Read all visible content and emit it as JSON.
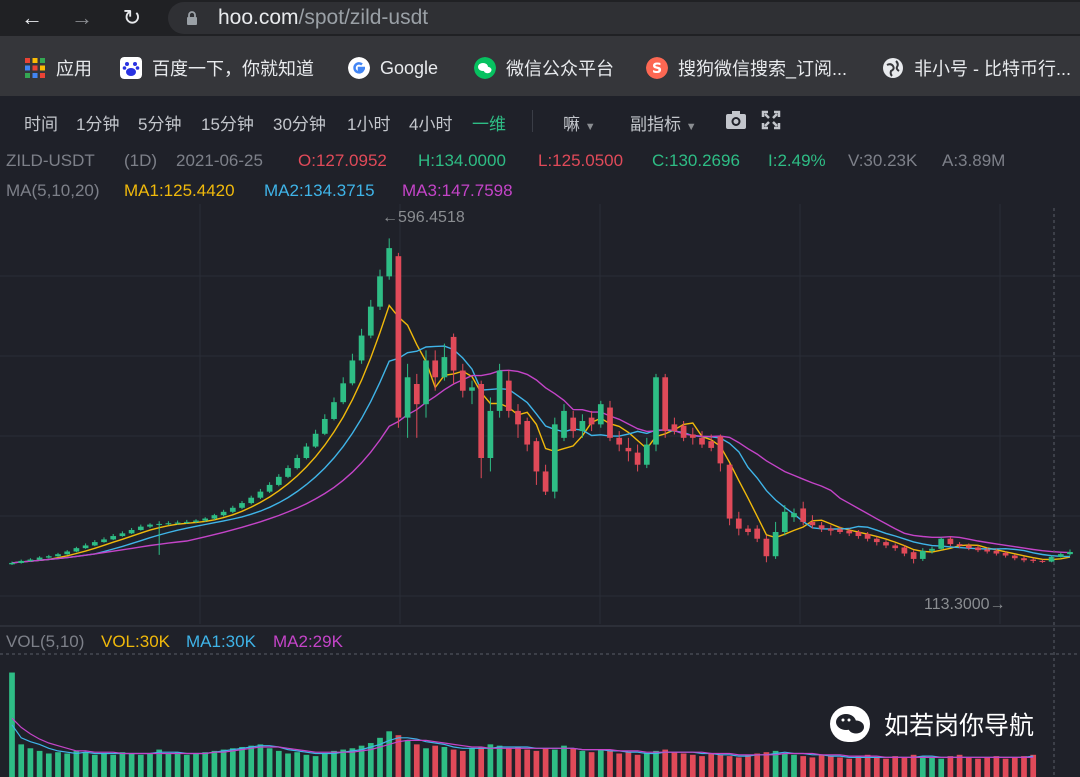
{
  "browser": {
    "url_host": "hoo.com",
    "url_path": "/spot/zild-usdt",
    "bookmarks": [
      "应用",
      "百度一下，你就知道",
      "Google",
      "微信公众平台",
      "搜狗微信搜索_订阅...",
      "非小号 - 比特币行..."
    ]
  },
  "toolbar": {
    "intervals": [
      "时间",
      "1分钟",
      "5分钟",
      "15分钟",
      "30分钟",
      "1小时",
      "4小时",
      "一维"
    ],
    "active_interval": "一维",
    "indicator_menu": "嘛",
    "sub_indicator_menu": "副指标"
  },
  "info": {
    "symbol": "ZILD-USDT",
    "period": "(1D)",
    "date": "2021-06-25",
    "open": "O:127.0952",
    "high": "H:134.0000",
    "low": "L:125.0500",
    "close": "C:130.2696",
    "change": "I:2.49%",
    "volume": "V:30.23K",
    "amount": "A:3.89M"
  },
  "ma": {
    "label": "MA(5,10,20)",
    "ma1": "MA1:125.4420",
    "ma2": "MA2:134.3715",
    "ma3": "MA3:147.7598"
  },
  "vol": {
    "label": "VOL(5,10)",
    "vol": "VOL:30K",
    "ma1": "MA1:30K",
    "ma2": "MA2:29K"
  },
  "annotations": {
    "high_label": "←596.4518",
    "low_label": "113.3000→"
  },
  "watermark": "如若岗你导航",
  "colors": {
    "up": "#2ebd85",
    "down": "#e04a59",
    "ma1": "#f0b90b",
    "ma2": "#3fb4e8",
    "ma3": "#c444c8"
  },
  "chart_data": {
    "type": "candlestick",
    "symbol": "ZILD-USDT",
    "interval": "1D",
    "price_range": [
      113.3,
      596.4518
    ],
    "candles": [
      {
        "o": 112.0,
        "c": 114.0,
        "h": 116.0,
        "l": 111.0
      },
      {
        "o": 114.0,
        "c": 117.0,
        "h": 119.0,
        "l": 113.0
      },
      {
        "o": 117.0,
        "c": 119.0,
        "h": 121.0,
        "l": 116.0
      },
      {
        "o": 119.0,
        "c": 122.0,
        "h": 124.0,
        "l": 118.0
      },
      {
        "o": 122.0,
        "c": 124.0,
        "h": 126.0,
        "l": 121.0
      },
      {
        "o": 124.0,
        "c": 127.0,
        "h": 129.0,
        "l": 123.0
      },
      {
        "o": 127.0,
        "c": 131.0,
        "h": 133.0,
        "l": 126.0
      },
      {
        "o": 131.0,
        "c": 136.0,
        "h": 138.0,
        "l": 130.0
      },
      {
        "o": 136.0,
        "c": 140.0,
        "h": 143.0,
        "l": 135.0
      },
      {
        "o": 140.0,
        "c": 145.0,
        "h": 148.0,
        "l": 139.0
      },
      {
        "o": 145.0,
        "c": 149.0,
        "h": 152.0,
        "l": 144.0
      },
      {
        "o": 149.0,
        "c": 154.0,
        "h": 157.0,
        "l": 148.0
      },
      {
        "o": 154.0,
        "c": 158.0,
        "h": 161.0,
        "l": 153.0
      },
      {
        "o": 158.0,
        "c": 163.0,
        "h": 166.0,
        "l": 157.0
      },
      {
        "o": 163.0,
        "c": 168.0,
        "h": 171.0,
        "l": 162.0
      },
      {
        "o": 168.0,
        "c": 171.0,
        "h": 173.0,
        "l": 166.0
      },
      {
        "o": 171.0,
        "c": 172.0,
        "h": 176.0,
        "l": 126.0
      },
      {
        "o": 172.0,
        "c": 173.0,
        "h": 176.0,
        "l": 170.0
      },
      {
        "o": 173.0,
        "c": 174.0,
        "h": 177.0,
        "l": 171.0
      },
      {
        "o": 174.0,
        "c": 175.0,
        "h": 178.0,
        "l": 172.0
      },
      {
        "o": 175.0,
        "c": 177.0,
        "h": 179.0,
        "l": 173.0
      },
      {
        "o": 177.0,
        "c": 180.0,
        "h": 182.0,
        "l": 175.0
      },
      {
        "o": 180.0,
        "c": 185.0,
        "h": 187.0,
        "l": 178.0
      },
      {
        "o": 185.0,
        "c": 190.0,
        "h": 193.0,
        "l": 183.0
      },
      {
        "o": 190.0,
        "c": 196.0,
        "h": 199.0,
        "l": 188.0
      },
      {
        "o": 196.0,
        "c": 203.0,
        "h": 206.0,
        "l": 194.0
      },
      {
        "o": 203.0,
        "c": 211.0,
        "h": 214.0,
        "l": 201.0
      },
      {
        "o": 211.0,
        "c": 220.0,
        "h": 224.0,
        "l": 209.0
      },
      {
        "o": 220.0,
        "c": 230.0,
        "h": 234.0,
        "l": 218.0
      },
      {
        "o": 230.0,
        "c": 242.0,
        "h": 246.0,
        "l": 228.0
      },
      {
        "o": 242.0,
        "c": 255.0,
        "h": 259.0,
        "l": 240.0
      },
      {
        "o": 255.0,
        "c": 270.0,
        "h": 275.0,
        "l": 253.0
      },
      {
        "o": 270.0,
        "c": 287.0,
        "h": 292.0,
        "l": 268.0
      },
      {
        "o": 287.0,
        "c": 306.0,
        "h": 312.0,
        "l": 285.0
      },
      {
        "o": 306.0,
        "c": 328.0,
        "h": 335.0,
        "l": 304.0
      },
      {
        "o": 328.0,
        "c": 353.0,
        "h": 360.0,
        "l": 326.0
      },
      {
        "o": 353.0,
        "c": 381.0,
        "h": 390.0,
        "l": 350.0
      },
      {
        "o": 381.0,
        "c": 415.0,
        "h": 425.0,
        "l": 378.0
      },
      {
        "o": 415.0,
        "c": 452.0,
        "h": 462.0,
        "l": 410.0
      },
      {
        "o": 452.0,
        "c": 495.0,
        "h": 505.0,
        "l": 448.0
      },
      {
        "o": 495.0,
        "c": 540.0,
        "h": 550.0,
        "l": 490.0
      },
      {
        "o": 540.0,
        "c": 582.0,
        "h": 596.4518,
        "l": 535.0
      },
      {
        "o": 570.0,
        "c": 330.0,
        "h": 575.0,
        "l": 315.0
      },
      {
        "o": 330.0,
        "c": 390.0,
        "h": 410.0,
        "l": 300.0
      },
      {
        "o": 380.0,
        "c": 350.0,
        "h": 395.0,
        "l": 300.0
      },
      {
        "o": 350.0,
        "c": 415.0,
        "h": 430.0,
        "l": 330.0
      },
      {
        "o": 415.0,
        "c": 390.0,
        "h": 430.0,
        "l": 370.0
      },
      {
        "o": 390.0,
        "c": 420.0,
        "h": 440.0,
        "l": 385.0
      },
      {
        "o": 450.0,
        "c": 400.0,
        "h": 455.0,
        "l": 380.0
      },
      {
        "o": 400.0,
        "c": 370.0,
        "h": 410.0,
        "l": 360.0
      },
      {
        "o": 370.0,
        "c": 375.0,
        "h": 385.0,
        "l": 350.0
      },
      {
        "o": 380.0,
        "c": 270.0,
        "h": 385.0,
        "l": 240.0
      },
      {
        "o": 270.0,
        "c": 340.0,
        "h": 360.0,
        "l": 250.0
      },
      {
        "o": 340.0,
        "c": 400.0,
        "h": 410.0,
        "l": 330.0
      },
      {
        "o": 385.0,
        "c": 340.0,
        "h": 400.0,
        "l": 330.0
      },
      {
        "o": 340.0,
        "c": 320.0,
        "h": 350.0,
        "l": 300.0
      },
      {
        "o": 325.0,
        "c": 290.0,
        "h": 330.0,
        "l": 280.0
      },
      {
        "o": 295.0,
        "c": 250.0,
        "h": 300.0,
        "l": 230.0
      },
      {
        "o": 250.0,
        "c": 220.0,
        "h": 260.0,
        "l": 215.0
      },
      {
        "o": 220.0,
        "c": 320.0,
        "h": 330.0,
        "l": 210.0
      },
      {
        "o": 300.0,
        "c": 340.0,
        "h": 350.0,
        "l": 295.0
      },
      {
        "o": 330.0,
        "c": 310.0,
        "h": 340.0,
        "l": 300.0
      },
      {
        "o": 310.0,
        "c": 325.0,
        "h": 335.0,
        "l": 300.0
      },
      {
        "o": 330.0,
        "c": 320.0,
        "h": 340.0,
        "l": 310.0
      },
      {
        "o": 320.0,
        "c": 350.0,
        "h": 355.0,
        "l": 315.0
      },
      {
        "o": 345.0,
        "c": 300.0,
        "h": 355.0,
        "l": 295.0
      },
      {
        "o": 300.0,
        "c": 290.0,
        "h": 310.0,
        "l": 280.0
      },
      {
        "o": 285.0,
        "c": 280.0,
        "h": 300.0,
        "l": 265.0
      },
      {
        "o": 278.0,
        "c": 260.0,
        "h": 290.0,
        "l": 250.0
      },
      {
        "o": 260.0,
        "c": 290.0,
        "h": 300.0,
        "l": 255.0
      },
      {
        "o": 290.0,
        "c": 390.0,
        "h": 395.0,
        "l": 280.0
      },
      {
        "o": 390.0,
        "c": 310.0,
        "h": 395.0,
        "l": 300.0
      },
      {
        "o": 320.0,
        "c": 310.0,
        "h": 330.0,
        "l": 305.0
      },
      {
        "o": 318.0,
        "c": 300.0,
        "h": 325.0,
        "l": 295.0
      },
      {
        "o": 305.0,
        "c": 300.0,
        "h": 315.0,
        "l": 290.0
      },
      {
        "o": 300.0,
        "c": 290.0,
        "h": 310.0,
        "l": 285.0
      },
      {
        "o": 295.0,
        "c": 285.0,
        "h": 305.0,
        "l": 280.0
      },
      {
        "o": 302.0,
        "c": 262.0,
        "h": 305.0,
        "l": 250.0
      },
      {
        "o": 260.0,
        "c": 180.0,
        "h": 262.0,
        "l": 170.0
      },
      {
        "o": 180.0,
        "c": 165.0,
        "h": 190.0,
        "l": 155.0
      },
      {
        "o": 165.0,
        "c": 160.0,
        "h": 170.0,
        "l": 155.0
      },
      {
        "o": 165.0,
        "c": 150.0,
        "h": 170.0,
        "l": 145.0
      },
      {
        "o": 150.0,
        "c": 124.0,
        "h": 155.0,
        "l": 115.0
      },
      {
        "o": 124.0,
        "c": 160.0,
        "h": 175.0,
        "l": 120.0
      },
      {
        "o": 160.0,
        "c": 190.0,
        "h": 200.0,
        "l": 155.0
      },
      {
        "o": 182.0,
        "c": 188.0,
        "h": 195.0,
        "l": 175.0
      },
      {
        "o": 195.0,
        "c": 175.0,
        "h": 205.0,
        "l": 170.0
      },
      {
        "o": 175.0,
        "c": 170.0,
        "h": 185.0,
        "l": 165.0
      },
      {
        "o": 170.0,
        "c": 165.0,
        "h": 175.0,
        "l": 160.0
      },
      {
        "o": 165.0,
        "c": 162.0,
        "h": 170.0,
        "l": 155.0
      },
      {
        "o": 164.0,
        "c": 160.0,
        "h": 168.0,
        "l": 157.0
      },
      {
        "o": 162.0,
        "c": 158.0,
        "h": 165.0,
        "l": 154.0
      },
      {
        "o": 160.0,
        "c": 154.0,
        "h": 163.0,
        "l": 150.0
      },
      {
        "o": 157.0,
        "c": 150.0,
        "h": 160.0,
        "l": 146.0
      },
      {
        "o": 150.0,
        "c": 145.0,
        "h": 153.0,
        "l": 140.0
      },
      {
        "o": 145.0,
        "c": 140.0,
        "h": 148.0,
        "l": 136.0
      },
      {
        "o": 140.0,
        "c": 136.0,
        "h": 143.0,
        "l": 132.0
      },
      {
        "o": 137.0,
        "c": 128.0,
        "h": 140.0,
        "l": 124.0
      },
      {
        "o": 130.0,
        "c": 120.0,
        "h": 133.0,
        "l": 113.3
      },
      {
        "o": 120.0,
        "c": 132.0,
        "h": 136.0,
        "l": 117.0
      },
      {
        "o": 132.0,
        "c": 135.0,
        "h": 138.0,
        "l": 128.0
      },
      {
        "o": 135.0,
        "c": 150.0,
        "h": 152.0,
        "l": 133.0
      },
      {
        "o": 150.0,
        "c": 142.0,
        "h": 153.0,
        "l": 139.0
      },
      {
        "o": 142.0,
        "c": 140.0,
        "h": 145.0,
        "l": 136.0
      },
      {
        "o": 140.0,
        "c": 136.0,
        "h": 143.0,
        "l": 133.0
      },
      {
        "o": 137.0,
        "c": 133.0,
        "h": 140.0,
        "l": 130.0
      },
      {
        "o": 134.0,
        "c": 131.0,
        "h": 137.0,
        "l": 128.0
      },
      {
        "o": 132.0,
        "c": 128.0,
        "h": 135.0,
        "l": 125.0
      },
      {
        "o": 129.0,
        "c": 125.0,
        "h": 131.0,
        "l": 122.0
      },
      {
        "o": 125.0,
        "c": 121.0,
        "h": 127.0,
        "l": 118.0
      },
      {
        "o": 121.0,
        "c": 118.0,
        "h": 124.0,
        "l": 115.0
      },
      {
        "o": 119.0,
        "c": 117.0,
        "h": 121.0,
        "l": 114.0
      },
      {
        "o": 117.0,
        "c": 116.0,
        "h": 119.0,
        "l": 114.0
      },
      {
        "o": 116.0,
        "c": 123.0,
        "h": 125.0,
        "l": 115.0
      },
      {
        "o": 123.0,
        "c": 127.0,
        "h": 129.0,
        "l": 122.0
      },
      {
        "o": 127.0952,
        "c": 130.2696,
        "h": 134.0,
        "l": 125.05
      }
    ],
    "volume": [
      80,
      25,
      22,
      20,
      18,
      19,
      18,
      20,
      19,
      17,
      18,
      17,
      19,
      18,
      17,
      18,
      21,
      18,
      19,
      17,
      18,
      19,
      20,
      21,
      22,
      23,
      24,
      25,
      22,
      20,
      18,
      19,
      17,
      16,
      18,
      20,
      21,
      22,
      24,
      26,
      30,
      35,
      32,
      28,
      25,
      22,
      24,
      23,
      21,
      20,
      22,
      23,
      25,
      24,
      22,
      23,
      21,
      20,
      22,
      21,
      24,
      22,
      20,
      19,
      21,
      20,
      18,
      19,
      17,
      18,
      20,
      21,
      19,
      18,
      17,
      16,
      18,
      17,
      16,
      15,
      17,
      18,
      19,
      20,
      18,
      17,
      16,
      15,
      17,
      16,
      15,
      14,
      16,
      17,
      15,
      14,
      16,
      15,
      17,
      16,
      15,
      14,
      16,
      17,
      15,
      14,
      15,
      16,
      14,
      15,
      16,
      17
    ],
    "volume_ma1": [
      40,
      30,
      27,
      25,
      22,
      20,
      19,
      18,
      19,
      18,
      18,
      18,
      18,
      18,
      18,
      18,
      19,
      19,
      19,
      18,
      18,
      18,
      19,
      20,
      21,
      22,
      23,
      24,
      24,
      23,
      21,
      20,
      19,
      18,
      18,
      18,
      19,
      20,
      21,
      23,
      25,
      28,
      30,
      30,
      29,
      27,
      26,
      25,
      23,
      22,
      22,
      22,
      22,
      23,
      23,
      23,
      23,
      22,
      22,
      22,
      22,
      22,
      21,
      21,
      21,
      20,
      20,
      19,
      19,
      18,
      18,
      19,
      19,
      19,
      19,
      18,
      18,
      17,
      17,
      16,
      16,
      17,
      17,
      18,
      19,
      18,
      18,
      17,
      17,
      16,
      16,
      15,
      15,
      15,
      15,
      15,
      15,
      15,
      15,
      16,
      16,
      15,
      15,
      15,
      15,
      15,
      15,
      15,
      15,
      15,
      15,
      16
    ],
    "volume_ma2": [
      45,
      38,
      33,
      29,
      26,
      24,
      22,
      20,
      20,
      19,
      19,
      19,
      18,
      18,
      18,
      18,
      18,
      18,
      18,
      18,
      18,
      18,
      19,
      19,
      20,
      21,
      22,
      23,
      23,
      23,
      22,
      21,
      20,
      19,
      19,
      19,
      19,
      19,
      20,
      21,
      23,
      25,
      27,
      28,
      28,
      28,
      27,
      26,
      25,
      24,
      23,
      23,
      22,
      22,
      22,
      22,
      22,
      22,
      22,
      22,
      22,
      22,
      21,
      21,
      21,
      21,
      20,
      20,
      20,
      19,
      19,
      19,
      19,
      19,
      19,
      19,
      18,
      18,
      18,
      17,
      17,
      17,
      17,
      17,
      18,
      18,
      18,
      18,
      17,
      17,
      17,
      16,
      16,
      16,
      16,
      15,
      15,
      15,
      15,
      15,
      15,
      15,
      15,
      15,
      15,
      15,
      15,
      15,
      15,
      15,
      15,
      15
    ]
  }
}
